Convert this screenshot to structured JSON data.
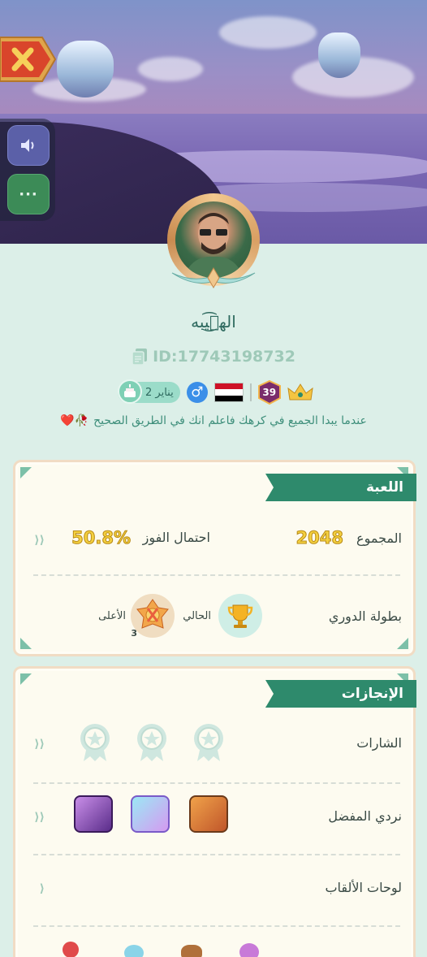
{
  "profile": {
    "username": "الهٖ͜͡يبه",
    "id_text": "ID:17743198732",
    "date_pill": "2 يناير",
    "gender_symbol": "♂",
    "level": "39",
    "bio": "عندما يبدا الجميع في كرهك فاعلم انك في الطريق الصحيح",
    "bio_emoji": "🥀❤️"
  },
  "buttons": {
    "close": "✕",
    "sound": "sound-icon",
    "more": "···"
  },
  "game_card": {
    "title": "اللعبة",
    "total_label": "المجموع",
    "total_value": "2048",
    "win_label": "احتمال الفوز",
    "win_value": "50.8%",
    "league_label": "بطولة الدوري",
    "current_label": "الحالي",
    "highest_label": "الأعلى",
    "highest_stars": "3"
  },
  "achievements_card": {
    "title": "الإنجازات",
    "badges_label": "الشارات",
    "dice_label": "نردي المفضل",
    "titles_label": "لوحات الألقاب"
  },
  "colors": {
    "accent": "#2e8a6c",
    "background": "#dcefe8",
    "card": "#fdfbf0",
    "gold": "#f4d03f"
  }
}
